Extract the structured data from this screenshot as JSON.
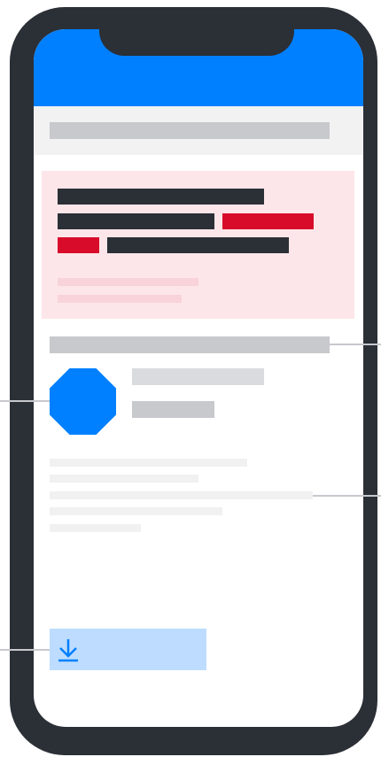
{
  "colors": {
    "device_frame": "#2b2f36",
    "header_blue": "#0080ff",
    "alert_background": "#fde6e9",
    "alert_red": "#d80b2b",
    "skeleton_dark": "#2b2f36",
    "skeleton_gray": "#c7c9cd",
    "skeleton_light": "#d9dbde",
    "skeleton_faint": "#f1f1f1",
    "button_background": "#bddcff"
  },
  "icons": {
    "avatar": "octagon-avatar-icon",
    "download": "download-icon"
  }
}
